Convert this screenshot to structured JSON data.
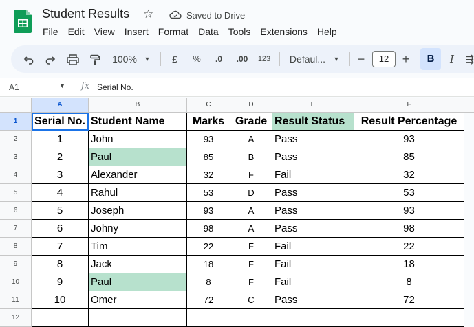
{
  "app": {
    "title": "Student Results",
    "status": "Saved to Drive",
    "menu": [
      "File",
      "Edit",
      "View",
      "Insert",
      "Format",
      "Data",
      "Tools",
      "Extensions",
      "Help"
    ]
  },
  "toolbar": {
    "zoom": "100%",
    "currency": "£",
    "percent": "%",
    "dec_decrease": ".0",
    "dec_increase": ".00",
    "number_format": "123",
    "font": "Defaul...",
    "font_size": "12",
    "bold": "B",
    "italic": "I"
  },
  "formula_bar": {
    "cell_ref": "A1",
    "fx": "fx",
    "value": "Serial No."
  },
  "sheet": {
    "columns": [
      "A",
      "B",
      "C",
      "D",
      "E",
      "F"
    ],
    "rows": [
      "1",
      "2",
      "3",
      "4",
      "5",
      "6",
      "7",
      "8",
      "9",
      "10",
      "11",
      "12"
    ],
    "header": [
      "Serial No.",
      "Student  Name",
      "Marks",
      "Grade",
      "Result Status",
      "Result Percentage"
    ],
    "data": [
      [
        "1",
        "John",
        "93",
        "A",
        "Pass",
        "93"
      ],
      [
        "2",
        "Paul",
        "85",
        "B",
        "Pass",
        "85"
      ],
      [
        "3",
        "Alexander",
        "32",
        "F",
        "Fail",
        "32"
      ],
      [
        "4",
        "Rahul",
        "53",
        "D",
        "Pass",
        "53"
      ],
      [
        "5",
        "Joseph",
        "93",
        "A",
        "Pass",
        "93"
      ],
      [
        "6",
        "Johny",
        "98",
        "A",
        "Pass",
        "98"
      ],
      [
        "7",
        "Tim",
        "22",
        "F",
        "Fail",
        "22"
      ],
      [
        "8",
        "Jack",
        "18",
        "F",
        "Fail",
        "18"
      ],
      [
        "9",
        "Paul",
        "8",
        "F",
        "Fail",
        "8"
      ],
      [
        "10",
        "Omer",
        "72",
        "C",
        "Pass",
        "72"
      ]
    ],
    "highlight_color": "#b7e1cd"
  }
}
